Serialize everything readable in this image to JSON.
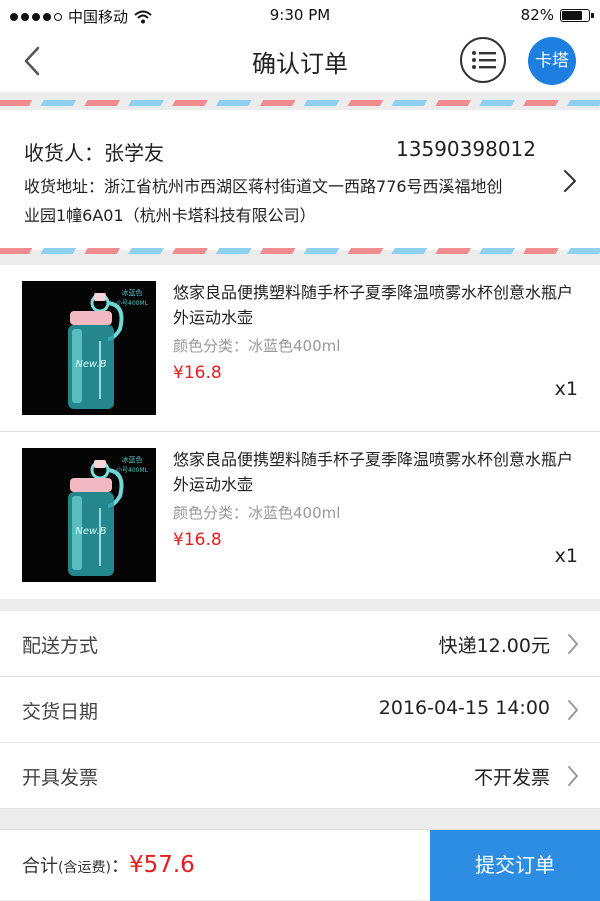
{
  "status_bar": {
    "carrier": "中国移动",
    "time": "9:30 PM",
    "battery": "82%",
    "battery_level": 0.82
  },
  "nav": {
    "title": "确认订单",
    "shop_label": "卡塔"
  },
  "address": {
    "name_label": "收货人：",
    "name": "张学友",
    "phone": "13590398012",
    "address_label": "收货地址：",
    "address": "浙江省杭州市西湖区蒋村街道文一西路776号西溪福地创业园1幢6A01（杭州卡塔科技有限公司）"
  },
  "products": [
    {
      "title": "悠家良品便携塑料随手杯子夏季降温喷雾水杯创意水瓶户外运动水壶",
      "spec_label": "颜色分类：",
      "spec": "冰蓝色400ml",
      "price": "¥16.8",
      "qty": "x1",
      "image_text_1": "冰蓝色",
      "image_text_2": "小号400ML",
      "image_brand": "New.B"
    },
    {
      "title": "悠家良品便携塑料随手杯子夏季降温喷雾水杯创意水瓶户外运动水壶",
      "spec_label": "颜色分类：",
      "spec": "冰蓝色400ml",
      "price": "¥16.8",
      "qty": "x1",
      "image_text_1": "冰蓝色",
      "image_text_2": "小号400ML",
      "image_brand": "New.B"
    }
  ],
  "options": [
    {
      "label": "配送方式",
      "value": "快递12.00元"
    },
    {
      "label": "交货日期",
      "value": "2016-04-15 14:00"
    },
    {
      "label": "开具发票",
      "value": "不开发票"
    }
  ],
  "footer": {
    "total_label": "合计",
    "total_note": "(含运费)",
    "colon": "：",
    "amount": "¥57.6",
    "submit_label": "提交订单"
  },
  "colors": {
    "accent": "#2d8de3",
    "price": "#e81c1c",
    "stripe_red": "#f08b8f",
    "stripe_blue": "#8fd0ef"
  },
  "icons": [
    "wifi-icon",
    "battery-icon",
    "back-icon",
    "list-menu-icon",
    "chevron-right-icon"
  ]
}
